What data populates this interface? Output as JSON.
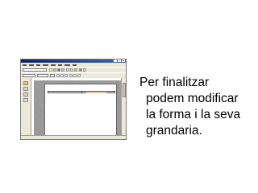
{
  "slide": {
    "caption_lines": [
      "Per finalitzar",
      "podem modificar",
      "la forma i la seva",
      "grandaria."
    ]
  },
  "screenshot": {
    "icons": [
      "minimize-icon",
      "maximize-icon",
      "close-icon",
      "new-document-icon",
      "open-icon",
      "save-icon",
      "print-icon",
      "cut-icon",
      "copy-icon",
      "paste-icon",
      "bold-icon",
      "italic-icon",
      "underline-icon",
      "align-left-icon",
      "align-center-icon",
      "align-right-icon"
    ],
    "colors": {
      "titlebar": "#0a246a",
      "chrome": "#ece9d8",
      "workspace": "#9a9a9a",
      "page": "#ffffff",
      "cell_text": "#c9a96b"
    }
  }
}
